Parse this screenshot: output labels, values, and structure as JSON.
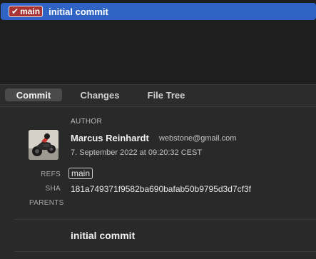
{
  "commit_list": {
    "rows": [
      {
        "branch": "main",
        "message": "initial commit",
        "selected": true
      }
    ]
  },
  "tabs": [
    {
      "label": "Commit",
      "active": true
    },
    {
      "label": "Changes",
      "active": false
    },
    {
      "label": "File Tree",
      "active": false
    }
  ],
  "details": {
    "author_caption": "AUTHOR",
    "author_name": "Marcus Reinhardt",
    "author_email": "webstone@gmail.com",
    "date": "7. September 2022 at 09:20:32 CEST",
    "refs_label": "REFS",
    "refs": [
      "main"
    ],
    "sha_label": "SHA",
    "sha": "181a749371f9582ba690bafab50b9795d3d7cf3f",
    "parents_label": "PARENTS",
    "message": "initial commit"
  },
  "icons": {
    "branch_check": "checkmark-icon",
    "avatar": "motorcycle-photo"
  },
  "colors": {
    "selection": "#2f63c4",
    "branch_badge": "#a83333",
    "background": "#242424"
  }
}
